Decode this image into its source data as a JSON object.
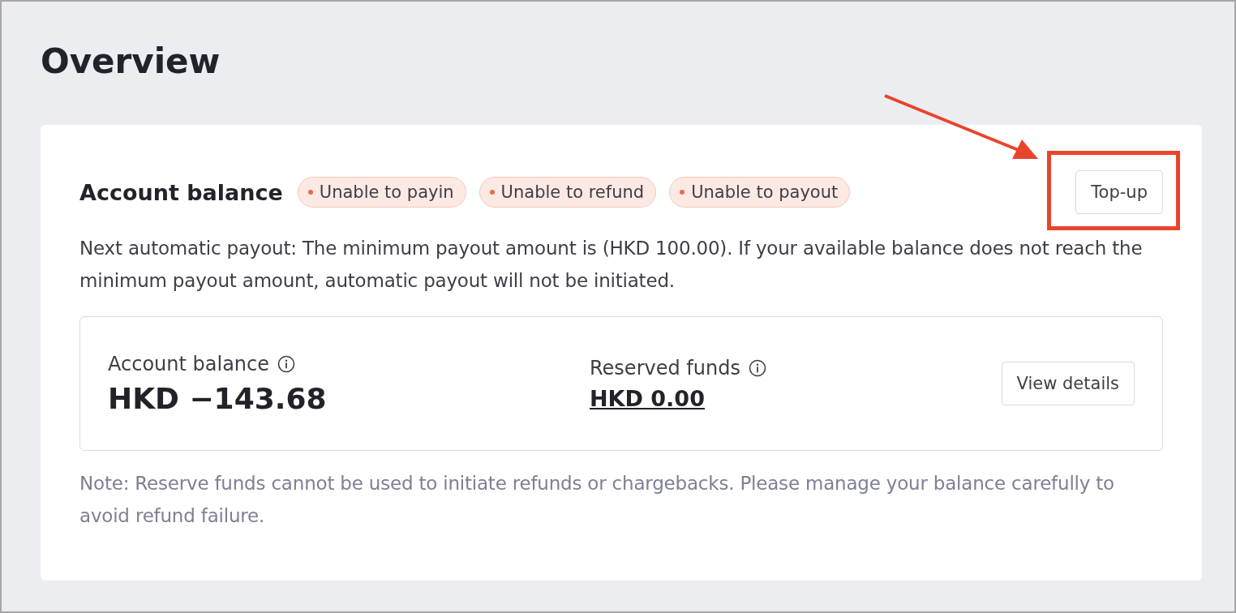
{
  "page": {
    "title": "Overview"
  },
  "card": {
    "heading": "Account balance",
    "badges": [
      {
        "label": "Unable to payin"
      },
      {
        "label": "Unable to refund"
      },
      {
        "label": "Unable to payout"
      }
    ],
    "topup_button": "Top-up",
    "notice": "Next automatic payout: The minimum payout amount is (HKD 100.00). If your available balance does not reach the minimum payout amount, automatic payout will not be initiated.",
    "balance": {
      "label": "Account balance",
      "amount": "HKD −143.68"
    },
    "reserved": {
      "label": "Reserved funds",
      "amount": "HKD 0.00"
    },
    "view_details_button": "View details",
    "note": "Note: Reserve funds cannot be used to initiate refunds or chargebacks. Please manage your balance carefully to avoid refund failure."
  }
}
